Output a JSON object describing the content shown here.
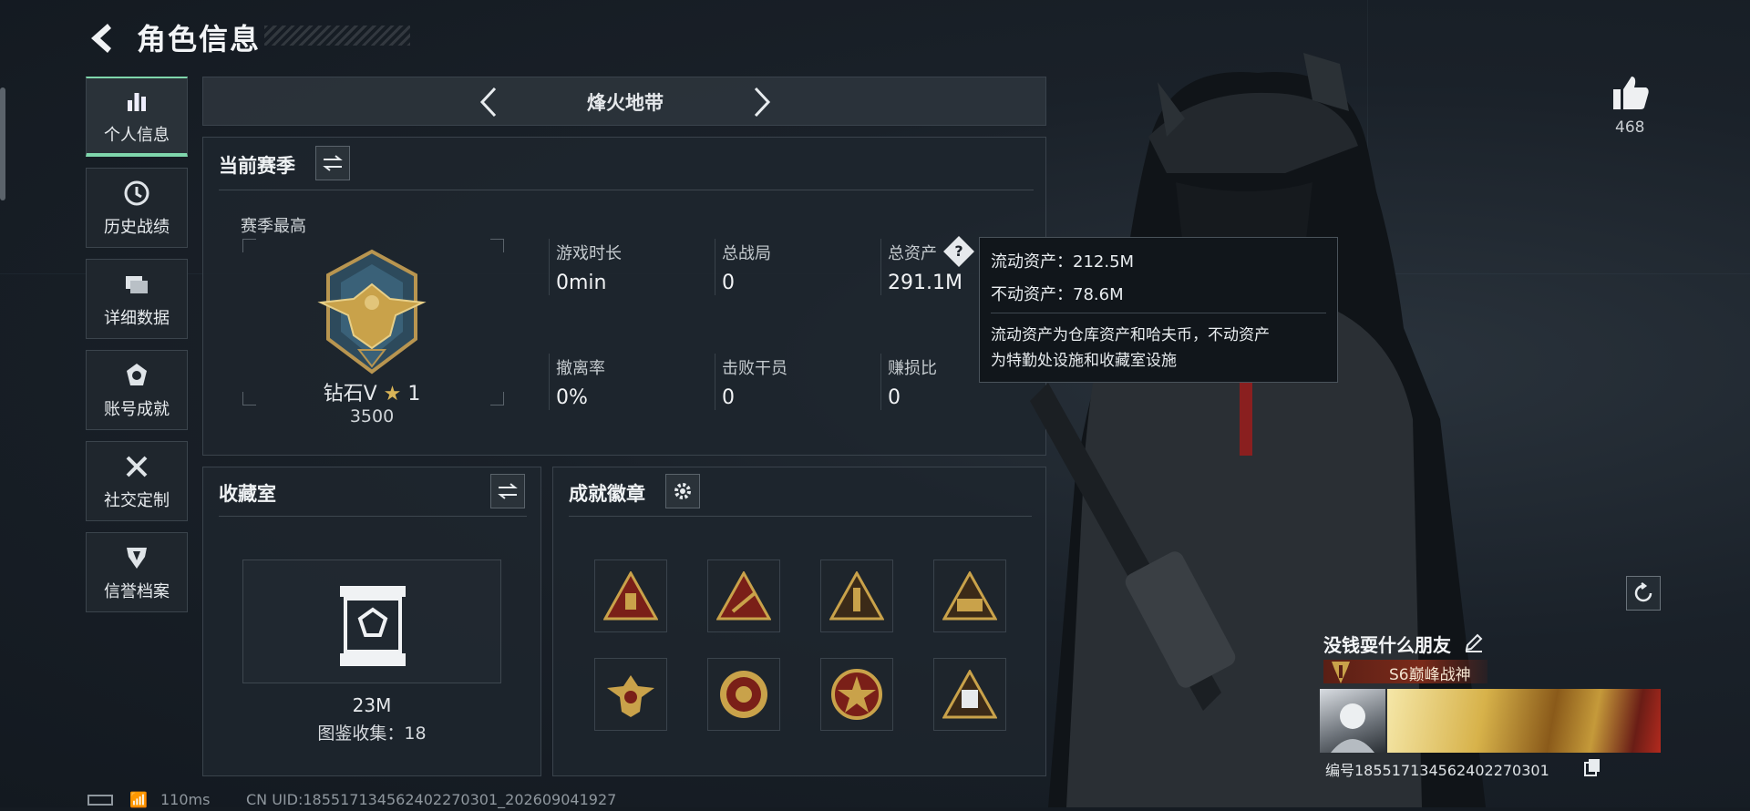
{
  "header": {
    "title": "角色信息"
  },
  "sidebar": {
    "items": [
      {
        "label": "个人信息",
        "icon": "bar-chart-icon",
        "active": true
      },
      {
        "label": "历史战绩",
        "icon": "clock-icon"
      },
      {
        "label": "详细数据",
        "icon": "folder-icon"
      },
      {
        "label": "账号成就",
        "icon": "achievement-icon"
      },
      {
        "label": "社交定制",
        "icon": "tools-icon"
      },
      {
        "label": "信誉档案",
        "icon": "shield-icon"
      }
    ]
  },
  "mode_selector": {
    "label": "烽火地带"
  },
  "season": {
    "title": "当前赛季",
    "best_label": "赛季最高",
    "rank_name": "钻石V",
    "rank_star": "1",
    "rank_score": "3500",
    "stats": [
      {
        "label": "游戏时长",
        "value": "0min"
      },
      {
        "label": "总战局",
        "value": "0"
      },
      {
        "label": "总资产",
        "value": "291.1M"
      },
      {
        "label": "撤离率",
        "value": "0%"
      },
      {
        "label": "击败干员",
        "value": "0"
      },
      {
        "label": "赚损比",
        "value": "0"
      }
    ]
  },
  "tooltip": {
    "liquid": "流动资产：212.5M",
    "fixed": "不动资产：78.6M",
    "desc_line1": "流动资产为仓库资产和哈夫币，不动资产",
    "desc_line2": "为特勤处设施和收藏室设施"
  },
  "collection": {
    "title": "收藏室",
    "value": "23M",
    "count": "图鉴收集：18"
  },
  "achievements": {
    "title": "成就徽章",
    "badge_count": 8
  },
  "profile": {
    "likes": "468",
    "name": "没钱耍什么朋友",
    "rank_title": "S6巅峰战神",
    "id_text": "编号1855171345624022703​01"
  },
  "status_bar": {
    "ping": "110ms",
    "uid": "CN UID:185517134562402270301_202609041927"
  },
  "colors": {
    "accent": "#7fd6ac",
    "gold": "#c9a24a",
    "badge_red": "#7a1f18"
  }
}
